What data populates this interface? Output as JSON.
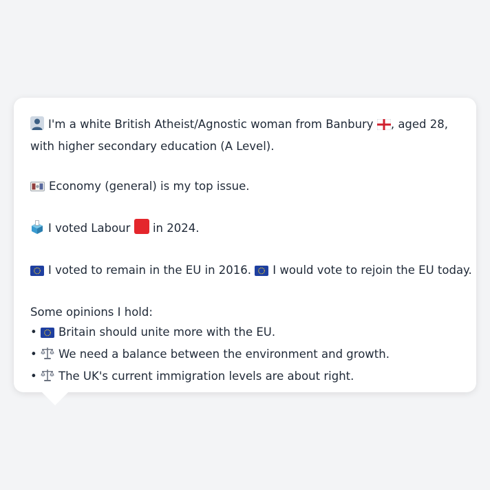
{
  "bio": {
    "person_emoji": "👤",
    "line1_text": "I'm a white British Atheist/Agnostic woman from Banbury",
    "flag_emoji": "🏴",
    "line1_suffix": ", aged 28,",
    "line2_text": "with higher secondary education (A Level)."
  },
  "issue": {
    "emoji": "💷",
    "text": "Economy (general) is my top issue."
  },
  "vote": {
    "emoji": "🗳️",
    "text_before": "I voted Labour",
    "party_color": "#e4262c",
    "text_after": "in 2024."
  },
  "eu": {
    "emoji": "🇪🇺",
    "text1": "I voted to remain in the EU in 2016.",
    "text2": "I would vote to rejoin the EU today."
  },
  "opinions": {
    "heading": "Some opinions I hold:",
    "bullet": "•",
    "items": [
      {
        "emoji": "🇪🇺",
        "text": "Britain should unite more with the EU."
      },
      {
        "emoji": "⚖️",
        "text": "We need a balance between the environment and growth."
      },
      {
        "emoji": "⚖️",
        "text": "The UK's current immigration levels are about right."
      }
    ]
  }
}
